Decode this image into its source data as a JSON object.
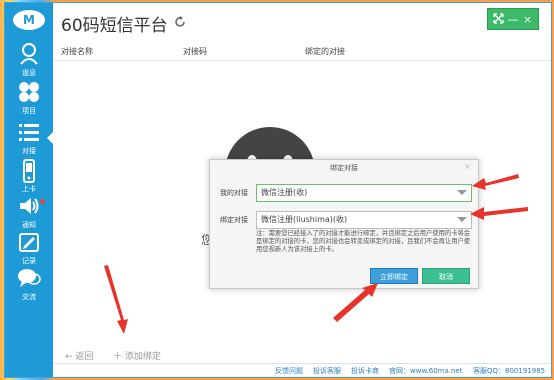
{
  "app": {
    "title": "60码短信平台"
  },
  "window_controls": {
    "minimize": "—",
    "close": "×"
  },
  "sidebar": {
    "items": [
      {
        "label": "道息",
        "icon": "person-icon"
      },
      {
        "label": "项目",
        "icon": "clover-icon"
      },
      {
        "label": "对接",
        "icon": "list-icon"
      },
      {
        "label": "上卡",
        "icon": "phone-icon"
      },
      {
        "label": "通知",
        "icon": "speaker-icon"
      },
      {
        "label": "记录",
        "icon": "note-icon"
      },
      {
        "label": "交流",
        "icon": "chat-icon"
      }
    ]
  },
  "table": {
    "headers": [
      "对接名称",
      "对接码",
      "绑定的对接"
    ]
  },
  "empty": {
    "text": "您"
  },
  "actions": {
    "back": "返回",
    "add_bind": "添加绑定"
  },
  "footer": {
    "feedback": "反馈问题",
    "complain_service": "投诉客服",
    "complain_merchant": "投诉卡商",
    "website": "官网：www.60ma.net",
    "qq": "客服QQ：800191985"
  },
  "dialog": {
    "title": "绑定对接",
    "my_label": "我的对接",
    "my_value": "微信注册(收)",
    "bind_label": "绑定对接",
    "bind_value": "微信注册(liushima)(收)",
    "note": "注：需要您已经接入了的对接才能进行绑定，并且绑定之后用户使用的卡将会是绑定的对接的卡，您的对接也会转变成绑定的对接，且我们不会再让用户使用您视新人为该对接上的卡。",
    "confirm": "立即绑定",
    "cancel": "取消"
  },
  "colors": {
    "sidebar": "#1e9bd7",
    "confirm": "#3d9fdd",
    "cancel": "#3cbf94",
    "arrow": "#e8332a"
  }
}
